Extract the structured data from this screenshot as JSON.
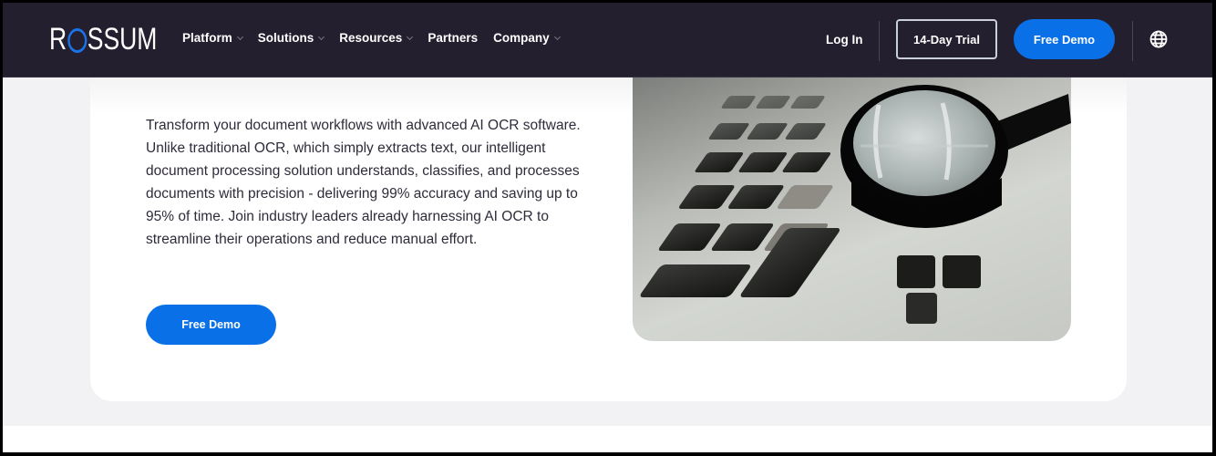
{
  "nav": {
    "logo": {
      "prefix": "R",
      "suffix": "SSUM",
      "ring_color": "#1a73e8"
    },
    "menu": [
      {
        "label": "Platform",
        "has_dropdown": true
      },
      {
        "label": "Solutions",
        "has_dropdown": true
      },
      {
        "label": "Resources",
        "has_dropdown": true
      },
      {
        "label": "Partners",
        "has_dropdown": false
      },
      {
        "label": "Company",
        "has_dropdown": true
      }
    ],
    "login_label": "Log In",
    "trial_label": "14-Day Trial",
    "demo_label": "Free Demo",
    "language_icon": "globe-icon",
    "background_color": "#241f2e",
    "accent_color": "#0a70e8"
  },
  "hero": {
    "description": "Transform your document workflows with advanced AI OCR software. Unlike traditional OCR, which simply extracts text, our intelligent document processing solution understands, classifies, and processes documents with precision - delivering 99% accuracy and saving up to 95% of time. Join industry leaders already harnessing AI OCR to streamline their operations and reduce manual effort.",
    "cta_label": "Free Demo",
    "image_alt": "magnifying glass on laptop keyboard"
  }
}
